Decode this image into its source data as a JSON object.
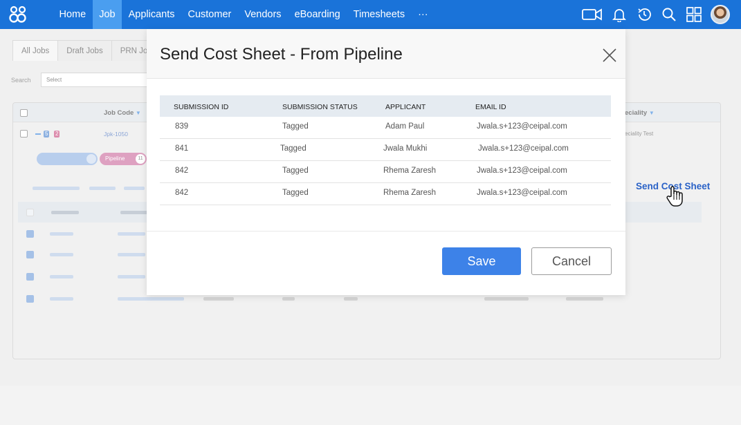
{
  "nav": {
    "items": [
      "Home",
      "Job",
      "Applicants",
      "Customer",
      "Vendors",
      "eBoarding",
      "Timesheets",
      "···"
    ],
    "active_index": 1
  },
  "background": {
    "tabs": [
      "All Jobs",
      "Draft Jobs",
      "PRN Jo"
    ],
    "search_label": "Search",
    "search_value": "Select",
    "col_job_code": "Job Code",
    "col_speciality": "eciality",
    "first_row_code": "Jpk-1050",
    "first_row_speciality": "eciality Test",
    "badges": [
      "5",
      "2"
    ],
    "pill_pipeline": "Pipeline",
    "pill_pipeline_count": "11",
    "send_link": "Send Cost Sheet"
  },
  "modal": {
    "title": "Send Cost Sheet - From Pipeline",
    "columns": [
      "SUBMISSION ID",
      "SUBMISSION STATUS",
      "APPLICANT",
      "EMAIL ID"
    ],
    "rows": [
      {
        "id": "839",
        "status": "Tagged",
        "applicant": "Adam Paul",
        "email": "Jwala.s+123@ceipal.com"
      },
      {
        "id": "841",
        "status": "Tagged",
        "applicant": "Jwala Mukhi",
        "email": "Jwala.s+123@ceipal.com"
      },
      {
        "id": "842",
        "status": "Tagged",
        "applicant": "Rhema Zaresh",
        "email": "Jwala.s+123@ceipal.com"
      },
      {
        "id": "842",
        "status": "Tagged",
        "applicant": "Rhema Zaresh",
        "email": "Jwala.s+123@ceipal.com"
      }
    ],
    "save_label": "Save",
    "cancel_label": "Cancel"
  },
  "colors": {
    "nav_bg": "#1a73d9",
    "nav_active": "#4a9ef0",
    "primary_button": "#3d82e8",
    "link": "#2a62c7"
  },
  "icons": [
    "app-logo-icon",
    "video-icon",
    "bell-icon",
    "history-icon",
    "search-icon",
    "grid-icon",
    "close-icon",
    "hand-pointer-icon"
  ]
}
